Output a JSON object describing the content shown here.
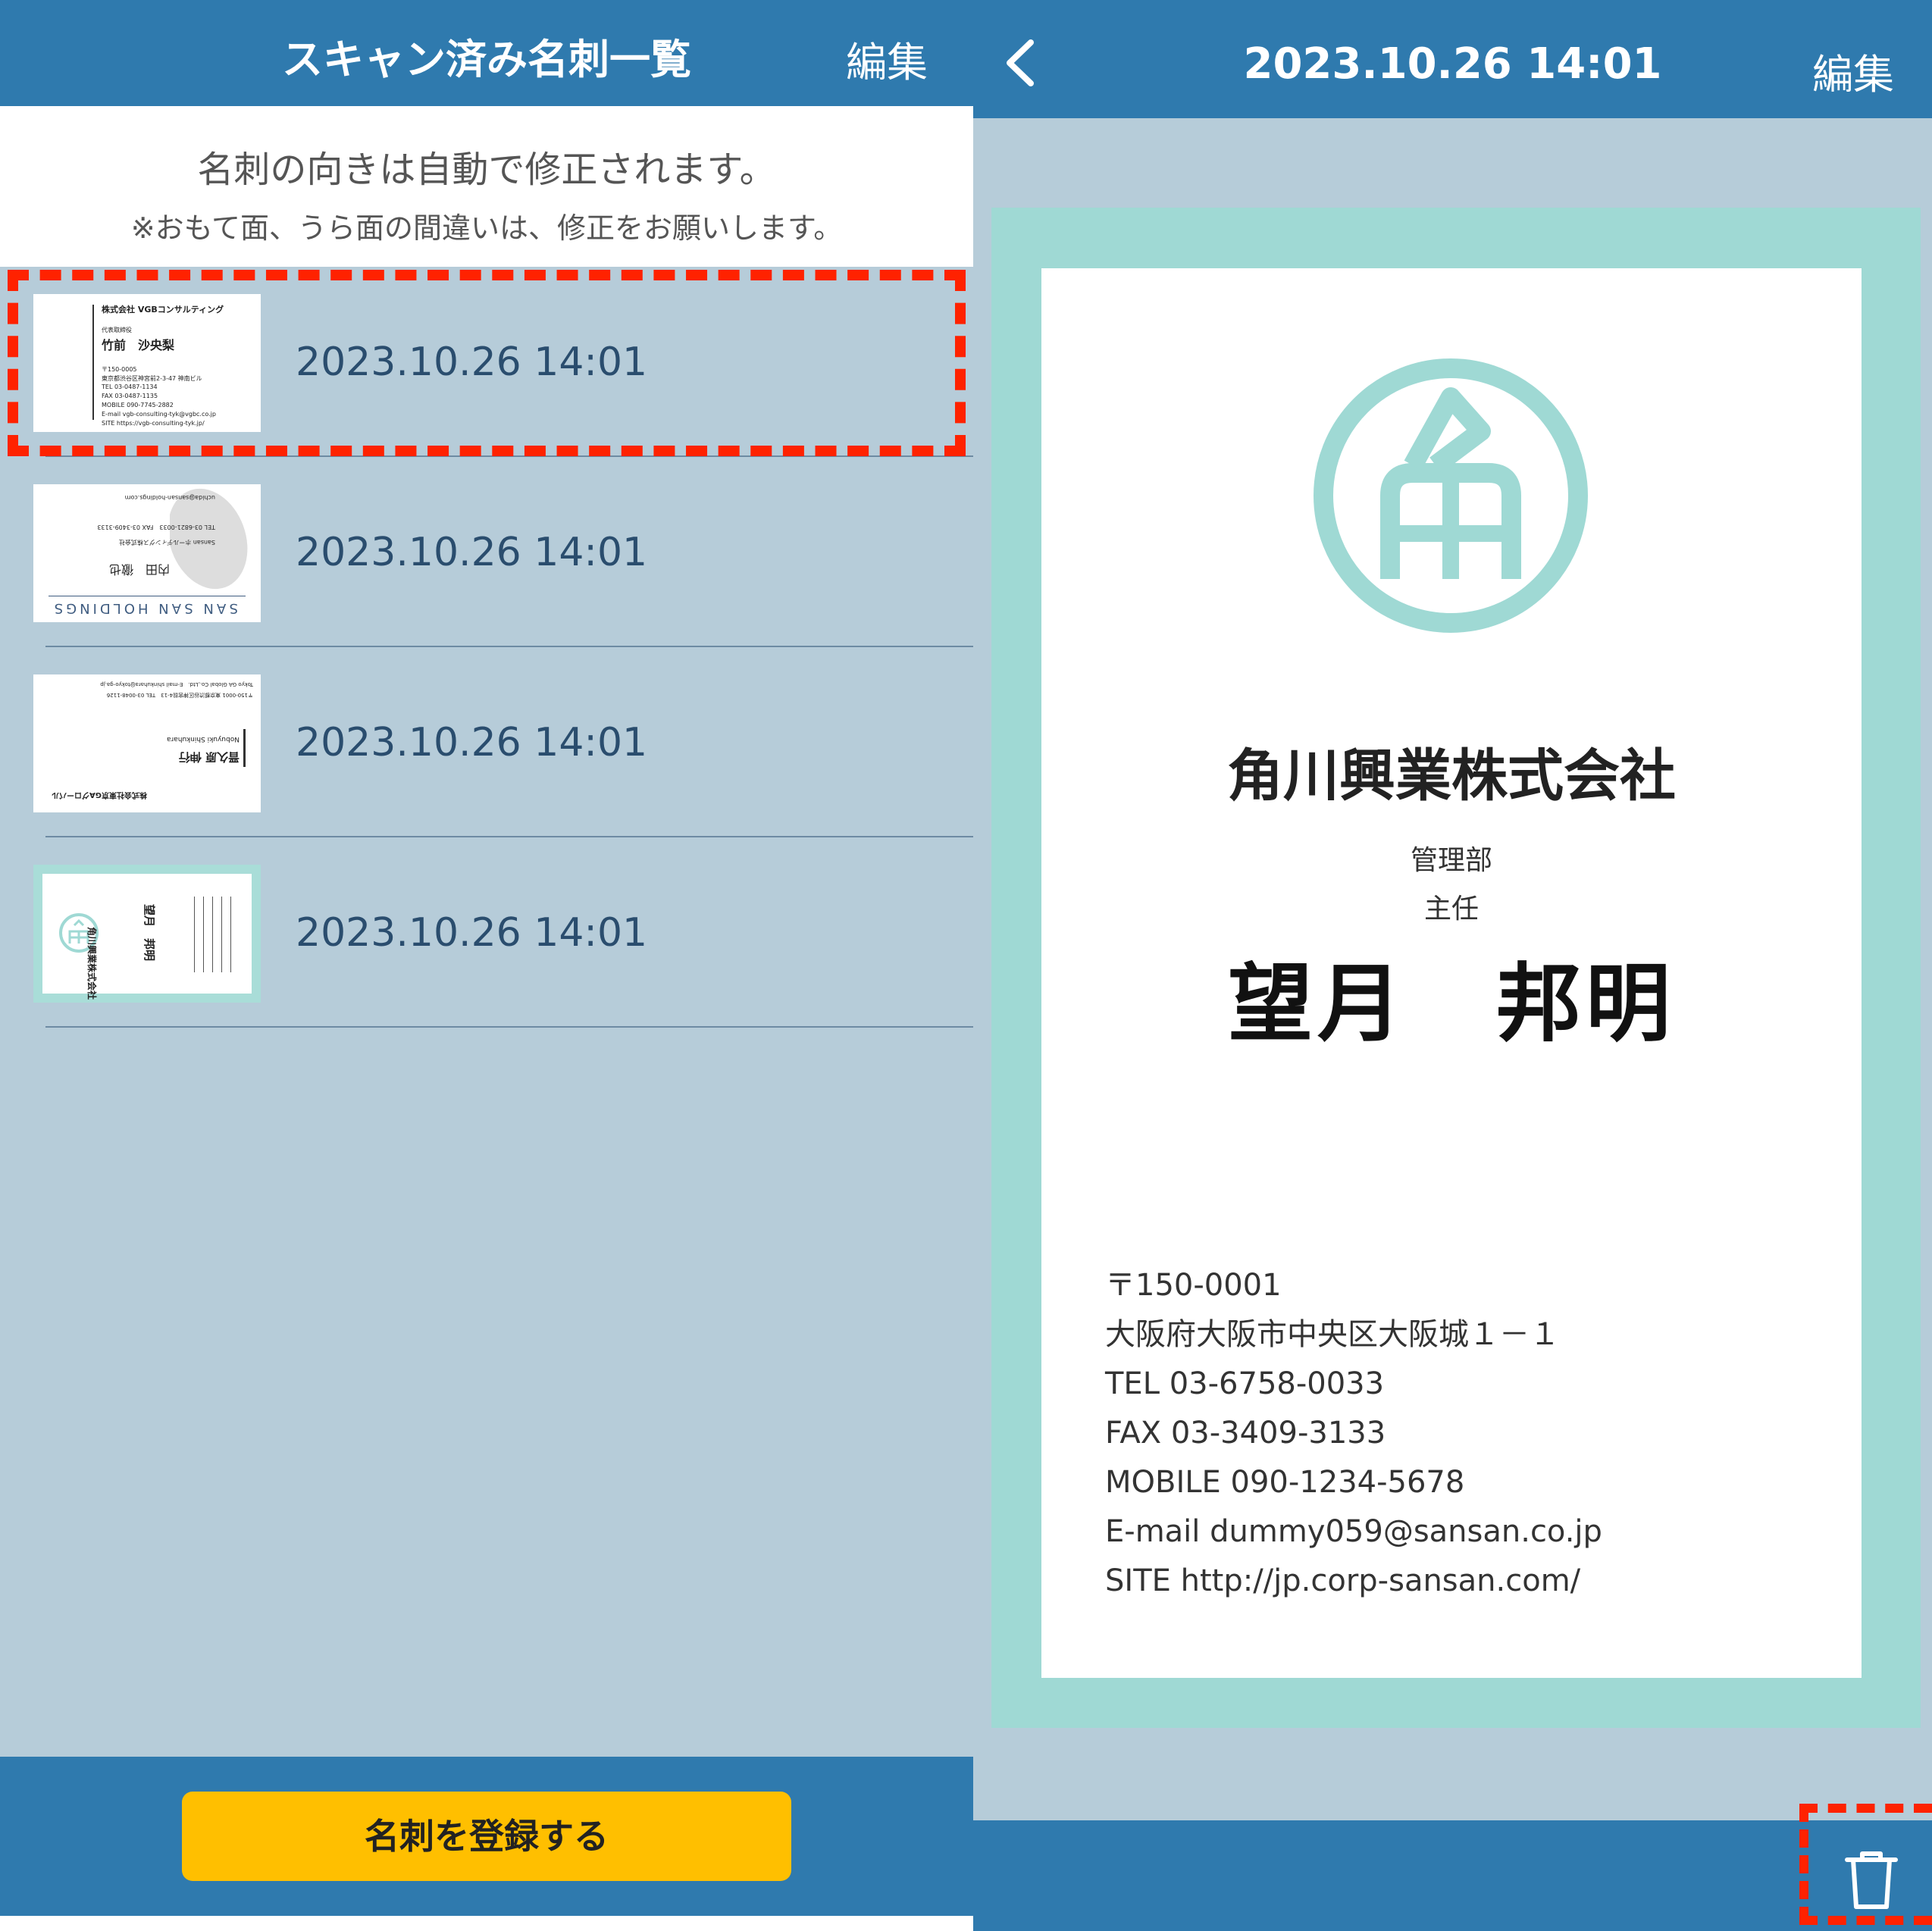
{
  "left": {
    "header": {
      "title": "スキャン済み名刺一覧",
      "edit_label": "編集"
    },
    "notice": {
      "line1": "名刺の向きは自動で修正されます。",
      "line2": "※おもて面、うら面の間違いは、修正をお願いします。"
    },
    "cards": [
      {
        "timestamp": "2023.10.26 14:01",
        "thumb": {
          "company": "株式会社 VGBコンサルティング",
          "title": "代表取締役",
          "name": "竹前　沙央梨",
          "lines": [
            "〒150-0005",
            "東京都渋谷区神宮前2-3-47 神南ビル",
            "TEL 03-0487-1134",
            "FAX 03-0487-1135",
            "MOBILE 090-7745-2882",
            "E-mail vgb-consulting-tyk@vgbc.co.jp",
            "SITE https://vgb-consulting-tyk.jp/"
          ]
        }
      },
      {
        "timestamp": "2023.10.26 14:01",
        "thumb": {
          "company": "SAN SAN HOLDINGS",
          "name": "内田　徹也",
          "lines": [
            "Sansan ホールディングス株式会社",
            "TEL 03-6821-0033　FAX 03-3409-3133",
            "uchida@sansan-holdings.com"
          ]
        }
      },
      {
        "timestamp": "2023.10.26 14:01",
        "thumb": {
          "company": "株式会社東京GAグローバル",
          "name": "晋久原 伸行",
          "romaji": "Nobuyuki Shinkuhara",
          "lines": [
            "〒150-0001 東京都渋谷区神宮前4-13　TEL 03-0048-1126",
            "Tokyo GA Global Co.,Ltd.　E-mail shinkuhara@tokyo-ga.jp"
          ]
        }
      },
      {
        "timestamp": "2023.10.26 14:01",
        "thumb": {
          "company": "角川興業株式会社",
          "name": "望月　邦明"
        }
      }
    ],
    "footer": {
      "register_label": "名刺を登録する"
    }
  },
  "right": {
    "header": {
      "title": "2023.10.26 14:01",
      "edit_label": "編集"
    },
    "card": {
      "company": "角川興業株式会社",
      "department": "管理部",
      "role": "主任",
      "name": "望月　邦明",
      "contact": [
        "〒150-0001",
        "大阪府大阪市中央区大阪城１－１",
        "TEL 03-6758-0033",
        "FAX 03-3409-3133",
        "MOBILE 090-1234-5678",
        "E-mail dummy059@sansan.co.jp",
        "SITE http://jp.corp-sansan.com/"
      ]
    }
  },
  "colors": {
    "header_blue": "#2f7aae",
    "panel_bg": "#b6ccd9",
    "register_yellow": "#ffbf00",
    "highlight_red": "#ff2200",
    "card_teal": "#9fd9d4"
  },
  "icons": {
    "back": "chevron-left-icon",
    "trash": "trash-icon",
    "logo": "kado-logo-icon"
  }
}
